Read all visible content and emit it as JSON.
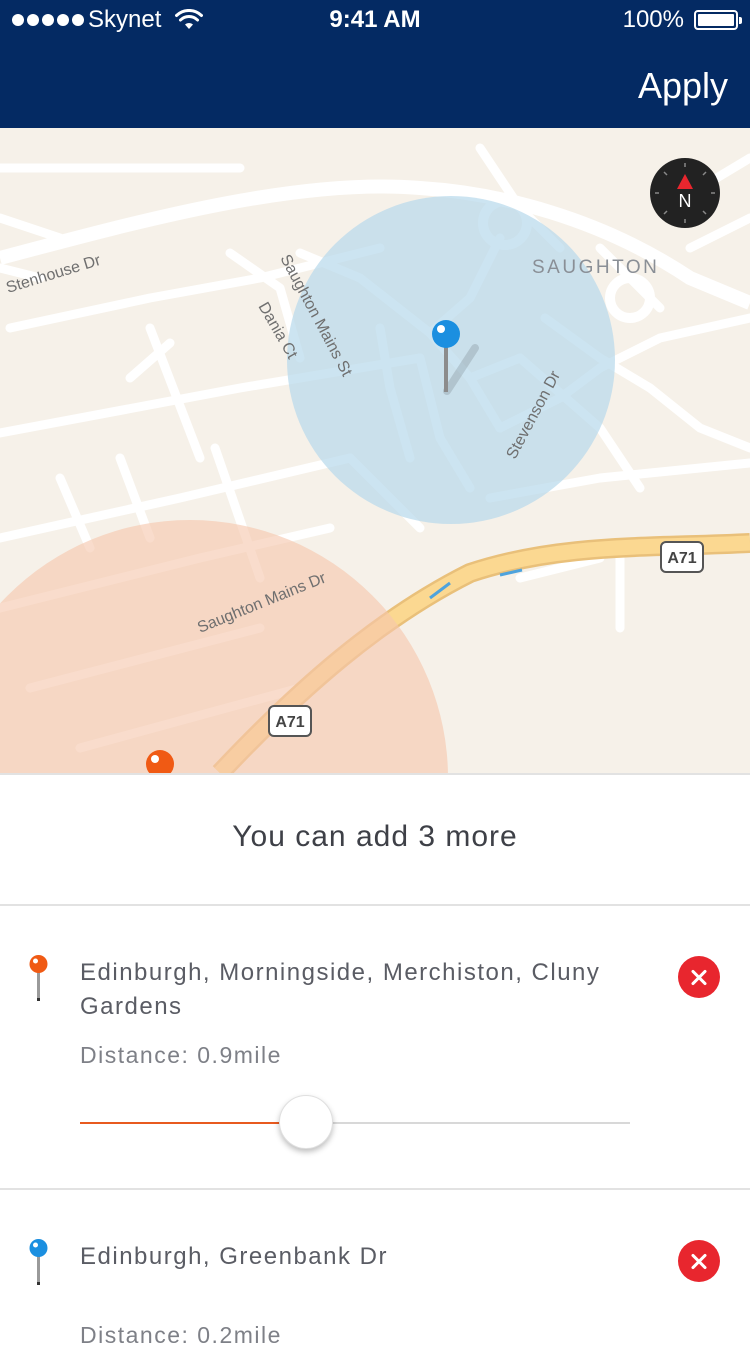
{
  "status_bar": {
    "carrier": "Skynet",
    "time": "9:41 AM",
    "battery": "100%"
  },
  "nav": {
    "apply_label": "Apply"
  },
  "map": {
    "labels": {
      "stenhouse": "Stenhouse Dr",
      "saughton_mains_st": "Saughton Mains St",
      "dania": "Dania Ct",
      "saughton": "SAUGHTON",
      "stevenson": "Stevenson Dr",
      "saughton_mains_dr": "Saughton Mains Dr",
      "a71_right": "A71",
      "a71_left": "A71"
    },
    "compass_label": "N",
    "colors": {
      "background": "#f6f1e9",
      "road": "#ffffff",
      "highway": "#f9cf86",
      "blue_zone": "#b8d9ec",
      "orange_zone": "#f6c6ad",
      "blue_pin": "#1b8fe0",
      "orange_pin": "#f05a14"
    }
  },
  "summary": {
    "text": "You can add 3 more"
  },
  "locations": [
    {
      "title": "Edinburgh, Morningside, Merchiston, Cluny Gardens",
      "distance": "Distance: 0.9mile",
      "pin_icon": "orange-pin-icon",
      "slider_fraction": 0.41
    },
    {
      "title": "Edinburgh, Greenbank Dr",
      "distance": "Distance: 0.2mile",
      "pin_icon": "blue-pin-icon"
    }
  ]
}
